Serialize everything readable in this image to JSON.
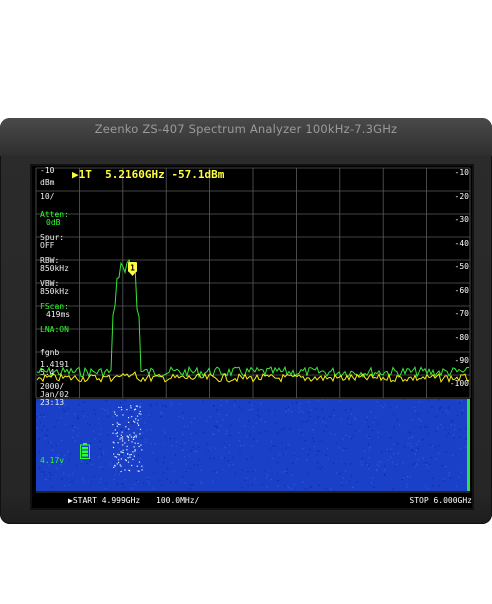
{
  "device": {
    "title": "Zeenko ZS-407   Spectrum Analyzer  100kHz-7.3GHz"
  },
  "marker": {
    "readout": "▶1T  5.2160GHz -57.1dBm",
    "badge": "1"
  },
  "left_panel": {
    "ref_level": "-10",
    "ref_unit": "dBm",
    "scale": "10/",
    "atten_label": "Atten:",
    "atten_value": "0dB",
    "spur_label": "Spur:",
    "spur_value": "OFF",
    "rbw_label": "RBW:",
    "rbw_value": "850kHz",
    "vbw_label": "VBW:",
    "vbw_value": "850kHz",
    "fscan_label": "FScan:",
    "fscan_value": "419ms",
    "lna": "LNA:ON",
    "fgnb": "fgnb",
    "fgnb_value1": "1.4191",
    "fgnb_value2": "5.4",
    "date_year": "2000/",
    "date_day": "Jan/02",
    "time": "23:13",
    "battery_voltage": "4.17v"
  },
  "right_scale": [
    "-10",
    "-20",
    "-30",
    "-40",
    "-50",
    "-60",
    "-70",
    "-80",
    "-90",
    "-100"
  ],
  "bottom_bar": {
    "start": "▶START 4.999GHz",
    "span": "100.0MHz/",
    "stop": "STOP 6.000GHz"
  },
  "colors": {
    "trace_green": "#38e838",
    "trace_yellow": "#f4f018",
    "waterfall_bg": "#1a40c8",
    "text_green": "#2dff2d",
    "marker_yellow": "#ffff40"
  }
}
